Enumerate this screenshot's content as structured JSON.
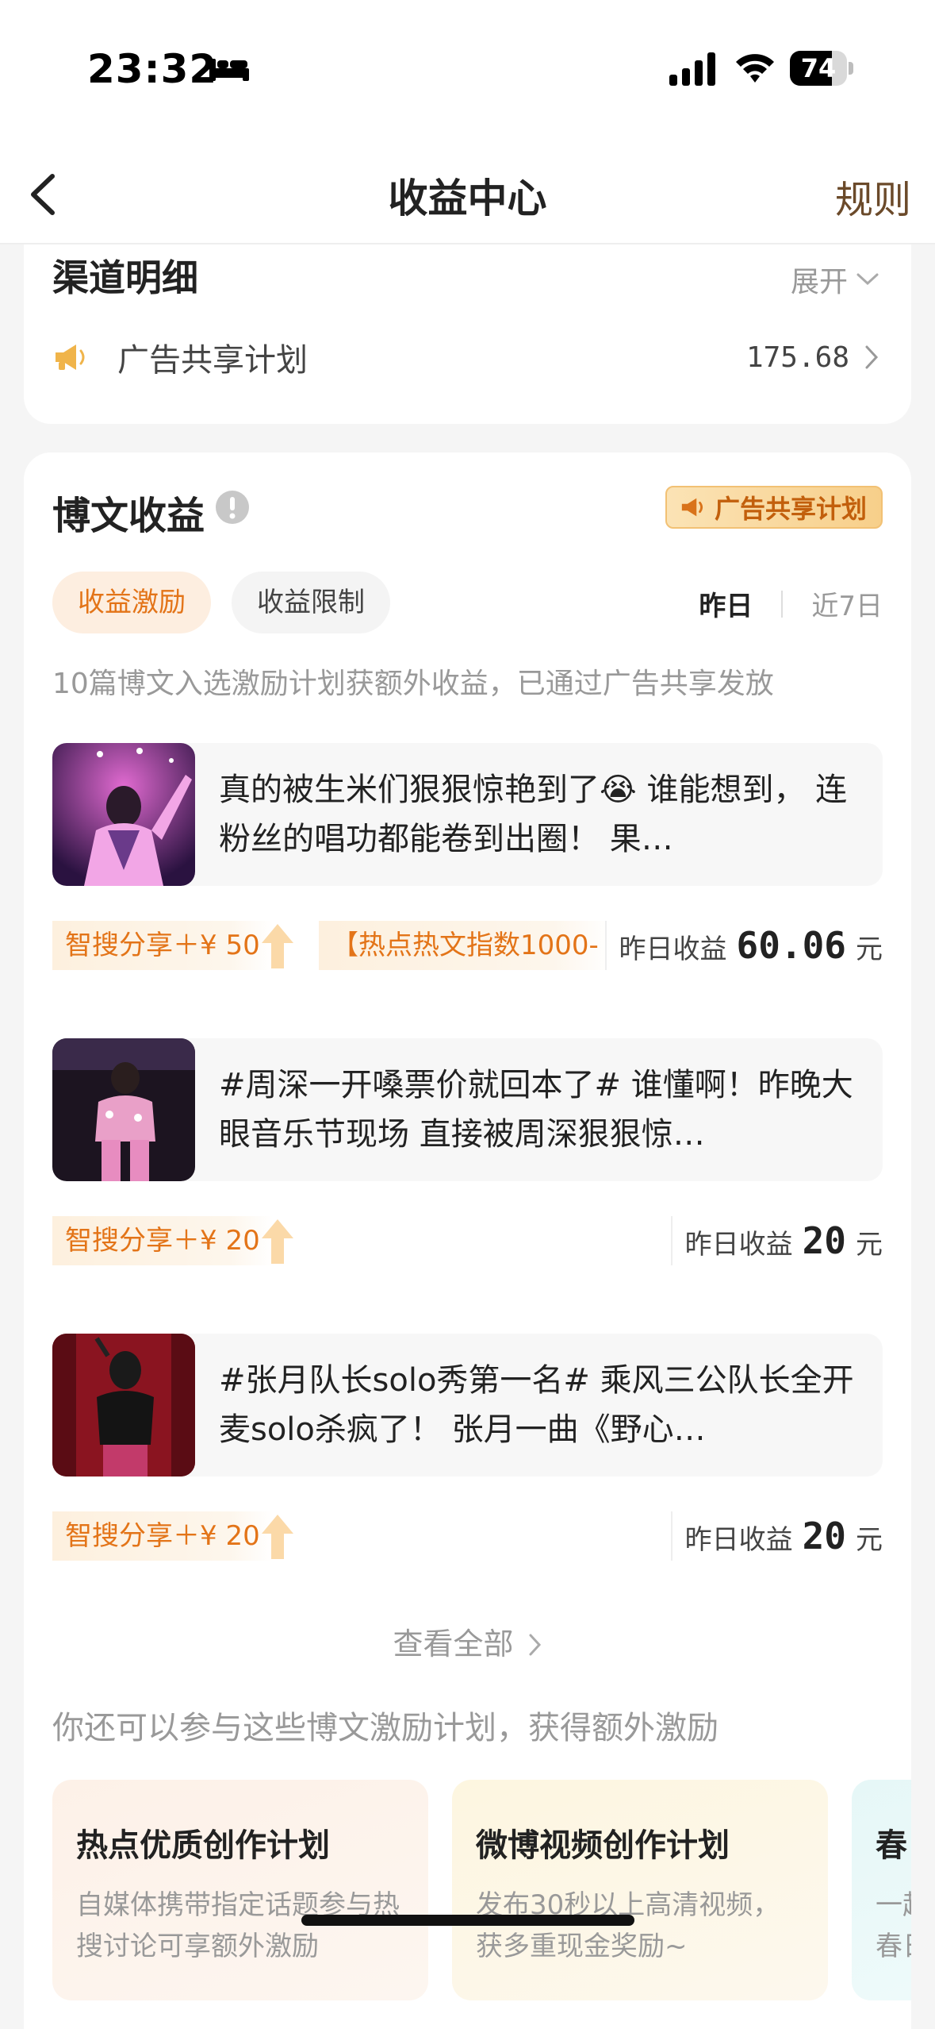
{
  "status_bar": {
    "time": "23:32",
    "battery": "74",
    "battery_level": 0.74
  },
  "nav": {
    "title": "收益中心",
    "rule_label": "规则"
  },
  "channel_card": {
    "title": "渠道明细",
    "expand_label": "展开",
    "rows": [
      {
        "name": "广告共享计划",
        "amount": "175.68"
      }
    ]
  },
  "posts_card": {
    "title": "博文收益",
    "ad_badge": "广告共享计划",
    "tabs": [
      "收益激励",
      "收益限制"
    ],
    "periods": [
      "昨日",
      "近7日"
    ],
    "description": "10篇博文入选激励计划获额外收益，已通过广告共享发放",
    "earn_label": "昨日收益",
    "earn_unit": "元",
    "posts": [
      {
        "text": "真的被生米们狠狠惊艳到了😭 谁能想到， 连粉丝的唱功都能卷到出圈！ 果…",
        "tags": [
          "智搜分享＋¥ 50",
          "【热点热文指数1000-"
        ],
        "earnings": "60.06"
      },
      {
        "text": "#周深一开嗓票价就回本了# 谁懂啊！昨晚大眼音乐节现场 直接被周深狠狠惊…",
        "tags": [
          "智搜分享＋¥ 20"
        ],
        "earnings": "20"
      },
      {
        "text": "#张月队长solo秀第一名# 乘风三公队长全开麦solo杀疯了！ 张月一曲《野心…",
        "tags": [
          "智搜分享＋¥ 20"
        ],
        "earnings": "20"
      }
    ],
    "view_all": "查看全部",
    "more_plans_desc": "你还可以参与这些博文激励计划，获得额外激励",
    "plans": [
      {
        "title": "热点优质创作计划",
        "desc": "自媒体携带指定话题参与热搜讨论可享额外激励"
      },
      {
        "title": "微博视频创作计划",
        "desc": "发布30秒以上高清视频，获多重现金奖励~"
      },
      {
        "title": "春",
        "desc": "一起\n春日"
      }
    ]
  },
  "colors": {
    "accent": "#e37418",
    "rule": "#6b4a2a",
    "badge_bg": "#f7cf8a"
  }
}
